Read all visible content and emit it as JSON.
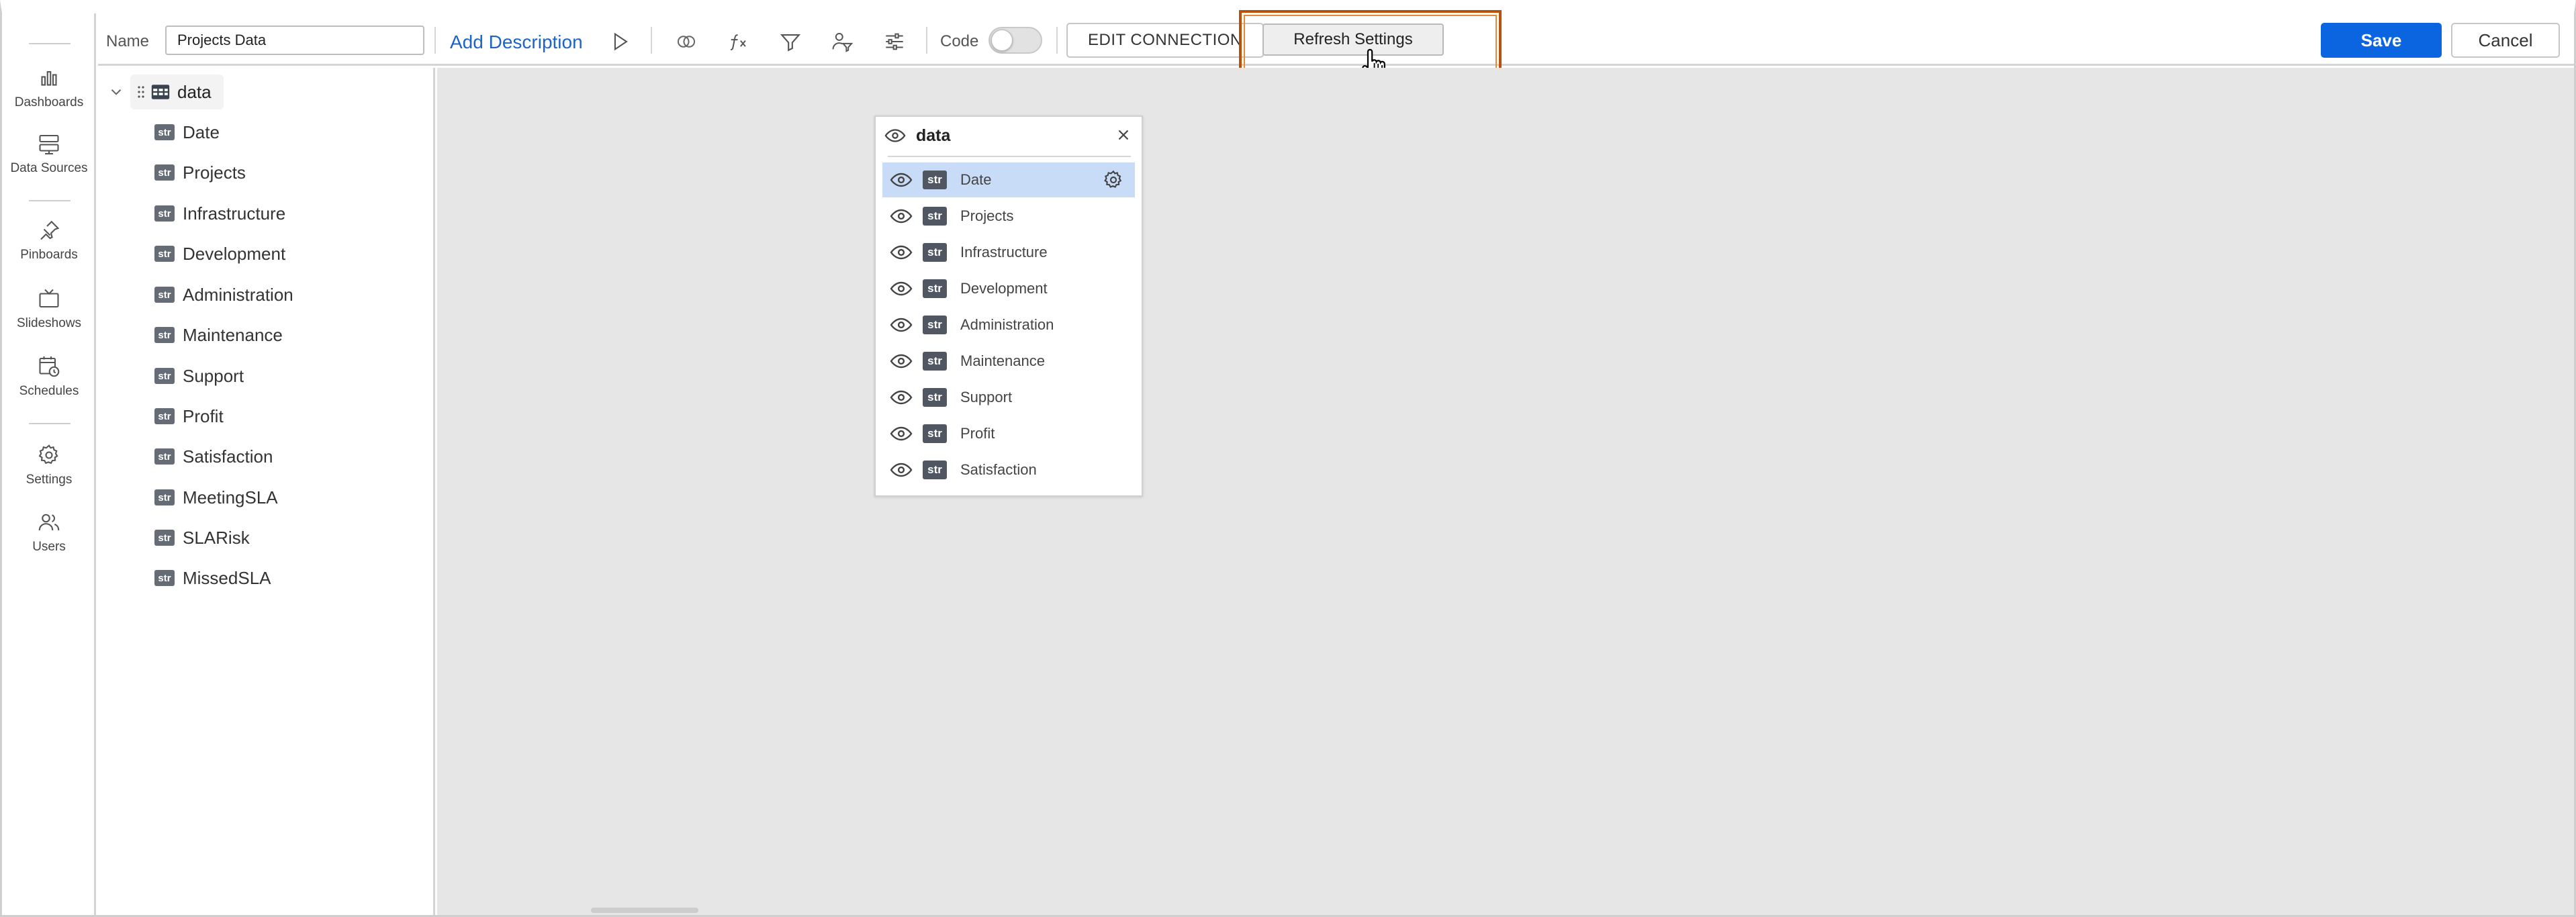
{
  "nav": {
    "items": [
      {
        "label": "Dashboards",
        "icon": "bar-chart-icon"
      },
      {
        "label": "Data Sources",
        "icon": "database-icon"
      },
      {
        "label": "Pinboards",
        "icon": "pin-icon"
      },
      {
        "label": "Slideshows",
        "icon": "tv-icon"
      },
      {
        "label": "Schedules",
        "icon": "calendar-clock-icon"
      },
      {
        "label": "Settings",
        "icon": "gear-icon"
      },
      {
        "label": "Users",
        "icon": "users-icon"
      }
    ]
  },
  "toolbar": {
    "name_label": "Name",
    "name_value": "Projects Data",
    "add_description": "Add Description",
    "code_label": "Code",
    "code_enabled": false,
    "edit_connection": "EDIT CONNECTION",
    "refresh_settings": "Refresh Settings",
    "save": "Save",
    "cancel": "Cancel"
  },
  "tree": {
    "root_label": "data",
    "type_badge": "str",
    "fields": [
      "Date",
      "Projects",
      "Infrastructure",
      "Development",
      "Administration",
      "Maintenance",
      "Support",
      "Profit",
      "Satisfaction",
      "MeetingSLA",
      "SLARisk",
      "MissedSLA"
    ]
  },
  "data_card": {
    "title": "data",
    "type_badge": "str",
    "selected": "Date",
    "fields": [
      "Date",
      "Projects",
      "Infrastructure",
      "Development",
      "Administration",
      "Maintenance",
      "Support",
      "Profit",
      "Satisfaction"
    ]
  },
  "colors": {
    "accent": "#0b65e0",
    "link": "#1e63c8",
    "highlight_border": "#b8510b",
    "selected_row": "#c9dcf7",
    "canvas": "#e6e6e6"
  }
}
